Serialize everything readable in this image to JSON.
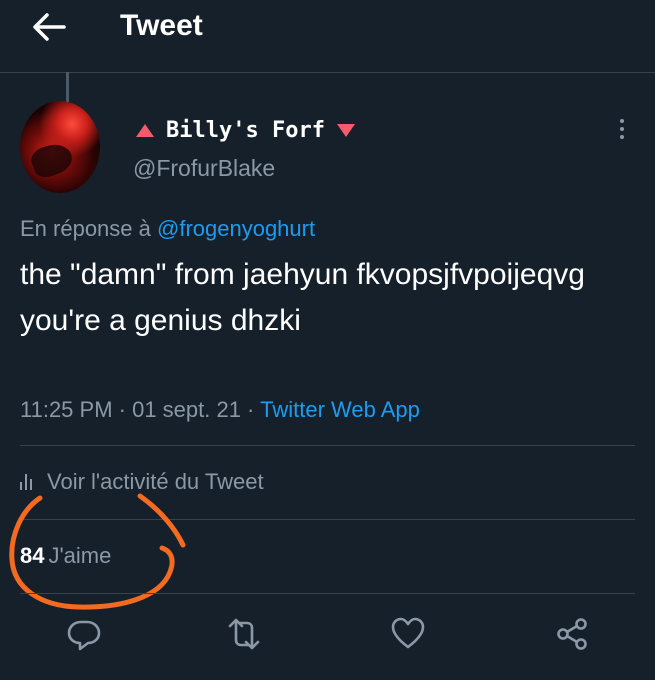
{
  "header": {
    "title": "Tweet",
    "back_icon": "back-arrow-icon"
  },
  "author": {
    "display_name": "Billy's Forf",
    "handle": "@FrofurBlake",
    "accent_color": "#f45b6b"
  },
  "reply": {
    "prefix": "En réponse à",
    "to": "@frogenyoghurt"
  },
  "tweet": {
    "text": "the \"damn\" from jaehyun fkvopsjfvpoijeqvg you're a genius dhzki",
    "time": "11:25 PM · 01 sept. 21 ·",
    "source": "Twitter Web App"
  },
  "activity": {
    "label": "Voir l'activité du Tweet"
  },
  "likes": {
    "count": "84",
    "label": "J'aime"
  },
  "actions": [
    "reply-icon",
    "retweet-icon",
    "like-icon",
    "share-icon"
  ],
  "colors": {
    "background": "#15202b",
    "muted": "#8b98a5",
    "link": "#1d9bf0",
    "divider": "#38444d",
    "annotation": "#f36a21"
  }
}
